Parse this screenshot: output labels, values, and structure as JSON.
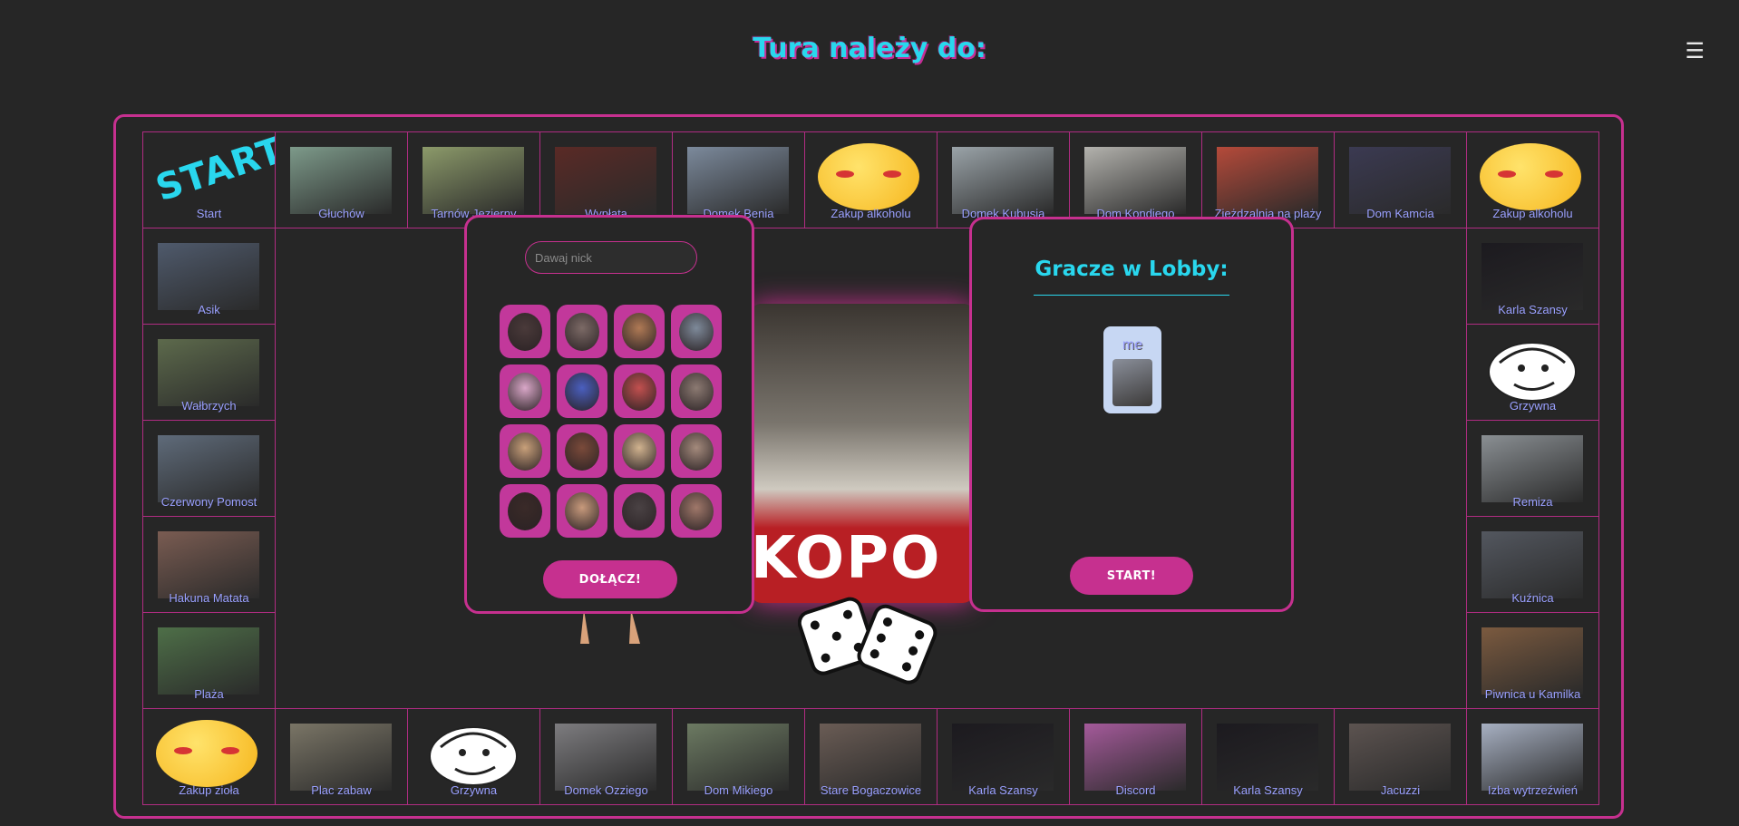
{
  "header": {
    "turn_label": "Tura należy do:"
  },
  "menu_icon": "☰",
  "board": {
    "start_label": "START",
    "tiles": [
      {
        "label": "Start",
        "icon": "start-icon"
      },
      {
        "label": "Głuchów",
        "color": "#7d9a8a"
      },
      {
        "label": "Tarnów Jezierny",
        "color": "#8c9a6a"
      },
      {
        "label": "Wypłata",
        "color": "#5a2a26"
      },
      {
        "label": "Domek Benia",
        "color": "#7c8a9c"
      },
      {
        "label": "Zakup alkoholu",
        "icon": "emoji-icon"
      },
      {
        "label": "Domek Kubusia",
        "color": "#9aa3a8"
      },
      {
        "label": "Dom Kondiego",
        "color": "#b3b2ad"
      },
      {
        "label": "Zjeżdzalnia na plaży",
        "color": "#b54a3a"
      },
      {
        "label": "Dom Kamcia",
        "color": "#3b3a52"
      },
      {
        "label": "Zakup alkoholu",
        "icon": "emoji-icon"
      },
      {
        "label": "Karla Szansy",
        "color": "#1c1a1f"
      },
      {
        "label": "Grzywna",
        "icon": "meme-icon"
      },
      {
        "label": "Remiza",
        "color": "#8a8f93"
      },
      {
        "label": "Kuźnica",
        "color": "#53575f"
      },
      {
        "label": "Piwnica u Kamilka",
        "color": "#7b5a3f"
      },
      {
        "label": "Izba wytrzeźwień",
        "color": "#a7b0c2"
      },
      {
        "label": "Jacuzzi",
        "color": "#5c5350"
      },
      {
        "label": "Karla Szansy",
        "color": "#1c1a1f"
      },
      {
        "label": "Discord",
        "color": "#a45a9a"
      },
      {
        "label": "Karla Szansy",
        "color": "#1c1a1f"
      },
      {
        "label": "Stare Bogaczowice",
        "color": "#6a5c55"
      },
      {
        "label": "Dom Mikiego",
        "color": "#6c7a62"
      },
      {
        "label": "Domek Ozziego",
        "color": "#7d7c7f"
      },
      {
        "label": "Grzywna",
        "icon": "meme-icon"
      },
      {
        "label": "Plac zabaw",
        "color": "#7a7566"
      },
      {
        "label": "Zakup zioła",
        "icon": "emoji-icon"
      },
      {
        "label": "Plaża",
        "color": "#4e6f48"
      },
      {
        "label": "Hakuna Matata",
        "color": "#7a5c52"
      },
      {
        "label": "Czerwony Pomost",
        "color": "#5f6b7a"
      },
      {
        "label": "Wałbrzych",
        "color": "#5d6a4c"
      },
      {
        "label": "Asik",
        "color": "#4f5a6c"
      }
    ]
  },
  "join_panel": {
    "nick_placeholder": "Dawaj nick",
    "join_label": "DOŁĄCZ!",
    "avatar_colors": [
      "#4a3a3a",
      "#7c6a66",
      "#b07a55",
      "#7e8a9a",
      "#d9a7c8",
      "#4a5fbf",
      "#c2504f",
      "#8c7a72",
      "#c8a07a",
      "#7a4a3a",
      "#d1b38f",
      "#a48a7c",
      "#3a2a28",
      "#c89a7c",
      "#4a4244",
      "#a0786a"
    ]
  },
  "lobby_panel": {
    "title": "Gracze w Lobby:",
    "players": [
      {
        "name": "me"
      }
    ],
    "start_label": "START!"
  },
  "colors": {
    "accent": "#c6308f",
    "cyan": "#29d7ee",
    "background": "#262626",
    "label": "#9aa0ff"
  }
}
